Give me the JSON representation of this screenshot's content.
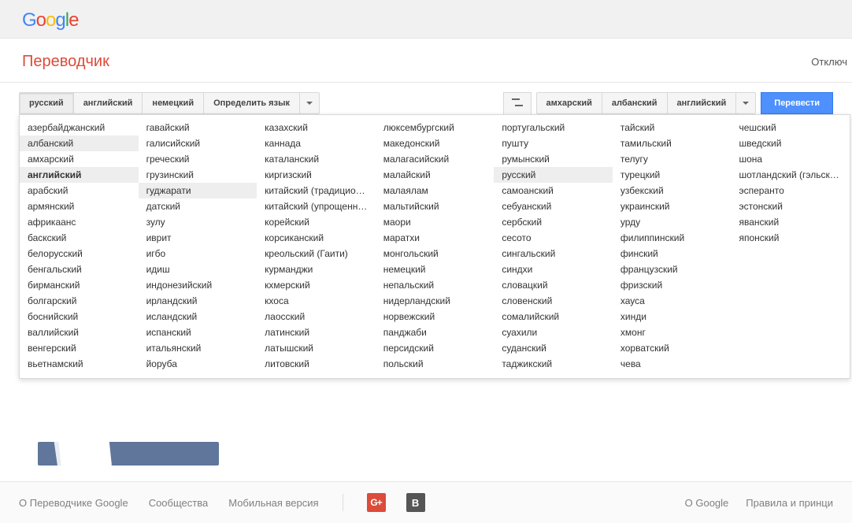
{
  "logo": {
    "g1": "G",
    "o1": "o",
    "o2": "o",
    "g2": "g",
    "l": "l",
    "e": "e"
  },
  "page_title": "Переводчик",
  "top_right_link": "Отключ",
  "source_tabs": {
    "items": [
      "русский",
      "английский",
      "немецкий",
      "Определить язык"
    ],
    "active_index": 0
  },
  "target_tabs": {
    "items": [
      "амхарский",
      "албанский",
      "английский"
    ],
    "active_index": null
  },
  "translate_button": "Перевести",
  "language_columns": [
    [
      {
        "t": "азербайджанский"
      },
      {
        "t": "албанский",
        "hl": true
      },
      {
        "t": "амхарский"
      },
      {
        "t": "английский",
        "hl": true,
        "bold": true
      },
      {
        "t": "арабский"
      },
      {
        "t": "армянский"
      },
      {
        "t": "африкаанс"
      },
      {
        "t": "баскский"
      },
      {
        "t": "белорусский"
      },
      {
        "t": "бенгальский"
      },
      {
        "t": "бирманский"
      },
      {
        "t": "болгарский"
      },
      {
        "t": "боснийский"
      },
      {
        "t": "валлийский"
      },
      {
        "t": "венгерский"
      },
      {
        "t": "вьетнамский"
      }
    ],
    [
      {
        "t": "гавайский"
      },
      {
        "t": "галисийский"
      },
      {
        "t": "греческий"
      },
      {
        "t": "грузинский"
      },
      {
        "t": "гуджарати",
        "hl": true
      },
      {
        "t": "датский"
      },
      {
        "t": "зулу"
      },
      {
        "t": "иврит"
      },
      {
        "t": "игбо"
      },
      {
        "t": "идиш"
      },
      {
        "t": "индонезийский"
      },
      {
        "t": "ирландский"
      },
      {
        "t": "исландский"
      },
      {
        "t": "испанский"
      },
      {
        "t": "итальянский"
      },
      {
        "t": "йоруба"
      }
    ],
    [
      {
        "t": "казахский"
      },
      {
        "t": "каннада"
      },
      {
        "t": "каталанский"
      },
      {
        "t": "киргизский"
      },
      {
        "t": "китайский (традиционный)"
      },
      {
        "t": "китайский (упрощенный)"
      },
      {
        "t": "корейский"
      },
      {
        "t": "корсиканский"
      },
      {
        "t": "креольский (Гаити)"
      },
      {
        "t": "курманджи"
      },
      {
        "t": "кхмерский"
      },
      {
        "t": "кхоса"
      },
      {
        "t": "лаосский"
      },
      {
        "t": "латинский"
      },
      {
        "t": "латышский"
      },
      {
        "t": "литовский"
      }
    ],
    [
      {
        "t": "люксембургский"
      },
      {
        "t": "македонский"
      },
      {
        "t": "малагасийский"
      },
      {
        "t": "малайский"
      },
      {
        "t": "малаялам"
      },
      {
        "t": "мальтийский"
      },
      {
        "t": "маори"
      },
      {
        "t": "маратхи"
      },
      {
        "t": "монгольский"
      },
      {
        "t": "немецкий"
      },
      {
        "t": "непальский"
      },
      {
        "t": "нидерландский"
      },
      {
        "t": "норвежский"
      },
      {
        "t": "панджаби"
      },
      {
        "t": "персидский"
      },
      {
        "t": "польский"
      }
    ],
    [
      {
        "t": "португальский"
      },
      {
        "t": "пушту"
      },
      {
        "t": "румынский"
      },
      {
        "t": "русский",
        "hl": true
      },
      {
        "t": "самоанский"
      },
      {
        "t": "себуанский"
      },
      {
        "t": "сербский"
      },
      {
        "t": "сесото"
      },
      {
        "t": "сингальский"
      },
      {
        "t": "синдхи"
      },
      {
        "t": "словацкий"
      },
      {
        "t": "словенский"
      },
      {
        "t": "сомалийский"
      },
      {
        "t": "суахили"
      },
      {
        "t": "суданский"
      },
      {
        "t": "таджикский"
      }
    ],
    [
      {
        "t": "тайский"
      },
      {
        "t": "тамильский"
      },
      {
        "t": "телугу"
      },
      {
        "t": "турецкий"
      },
      {
        "t": "узбекский"
      },
      {
        "t": "украинский"
      },
      {
        "t": "урду"
      },
      {
        "t": "филиппинский"
      },
      {
        "t": "финский"
      },
      {
        "t": "французский"
      },
      {
        "t": "фризский"
      },
      {
        "t": "хауса"
      },
      {
        "t": "хинди"
      },
      {
        "t": "хмонг"
      },
      {
        "t": "хорватский"
      },
      {
        "t": "чева"
      }
    ],
    [
      {
        "t": "чешский"
      },
      {
        "t": "шведский"
      },
      {
        "t": "шона"
      },
      {
        "t": "шотландский (гэльский)"
      },
      {
        "t": "эсперанто"
      },
      {
        "t": "эстонский"
      },
      {
        "t": "яванский"
      },
      {
        "t": "японский"
      }
    ]
  ],
  "footer": {
    "about_translator": "О Переводчике Google",
    "communities": "Сообщества",
    "mobile": "Мобильная версия",
    "about_google": "О Google",
    "privacy": "Правила и принци"
  }
}
